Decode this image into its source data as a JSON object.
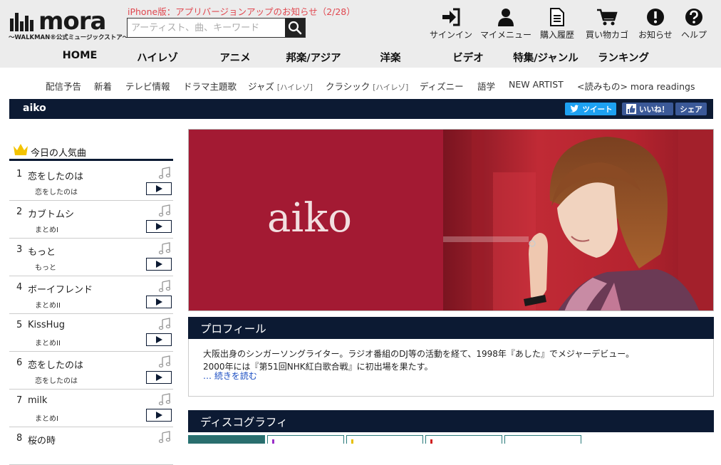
{
  "header": {
    "logo_text": "mora",
    "logo_sub": "〜WALKMAN®公式ミュージックストア〜",
    "notice": "iPhone版：アプリバージョンアップのお知らせ（2/28）",
    "search_placeholder": "アーティスト、曲、キーワード",
    "icons": [
      {
        "label": "サインイン",
        "icon": "signin-icon"
      },
      {
        "label": "マイメニュー",
        "icon": "user-icon"
      },
      {
        "label": "購入履歴",
        "icon": "document-icon"
      },
      {
        "label": "買い物カゴ",
        "icon": "cart-icon"
      },
      {
        "label": "お知らせ",
        "icon": "notice-icon"
      },
      {
        "label": "ヘルプ",
        "icon": "help-icon"
      }
    ]
  },
  "main_nav": [
    "HOME",
    "ハイレゾ",
    "アニメ",
    "邦楽/アジア",
    "洋楽",
    "ビデオ",
    "特集/ジャンル",
    "ランキング"
  ],
  "sub_nav": [
    {
      "label": "配信予告",
      "tag": ""
    },
    {
      "label": "新着",
      "tag": ""
    },
    {
      "label": "テレビ情報",
      "tag": ""
    },
    {
      "label": "ドラマ主題歌",
      "tag": ""
    },
    {
      "label": "ジャズ",
      "tag": "[ハイレゾ]"
    },
    {
      "label": "クラシック",
      "tag": "[ハイレゾ]"
    },
    {
      "label": "ディズニー",
      "tag": ""
    },
    {
      "label": "語学",
      "tag": ""
    },
    {
      "label": "NEW ARTIST",
      "tag": ""
    },
    {
      "label": "<読みもの> mora readings",
      "tag": ""
    }
  ],
  "artist": {
    "name": "aiko",
    "share": {
      "tweet": "ツイート",
      "like": "いいね！",
      "share": "シェア"
    }
  },
  "ranking": {
    "title": "今日の人気曲",
    "items": [
      {
        "rank": "1",
        "title": "恋をしたのは",
        "album": "恋をしたのは"
      },
      {
        "rank": "2",
        "title": "カブトムシ",
        "album": "まとめI"
      },
      {
        "rank": "3",
        "title": "もっと",
        "album": "もっと"
      },
      {
        "rank": "4",
        "title": "ボーイフレンド",
        "album": "まとめII"
      },
      {
        "rank": "5",
        "title": "KissHug",
        "album": "まとめII"
      },
      {
        "rank": "6",
        "title": "恋をしたのは",
        "album": "恋をしたのは"
      },
      {
        "rank": "7",
        "title": "milk",
        "album": "まとめI"
      },
      {
        "rank": "8",
        "title": "桜の時",
        "album": ""
      }
    ]
  },
  "hero": {
    "name": "aiko"
  },
  "profile": {
    "title": "プロフィール",
    "line1": "大阪出身のシンガーソングライター。ラジオ番組のDJ等の活動を経て、1998年『あした』でメジャーデビュー。",
    "line2": "2000年には『第51回NHK紅白歌合戦』に初出場を果たす。",
    "more": "… 続きを読む"
  },
  "discography": {
    "title": "ディスコグラフィ"
  },
  "colors": {
    "navy": "#0c1a33",
    "hero_red": "#a31a33",
    "notice_red": "#e0474f",
    "link_blue": "#1a4dc2"
  }
}
